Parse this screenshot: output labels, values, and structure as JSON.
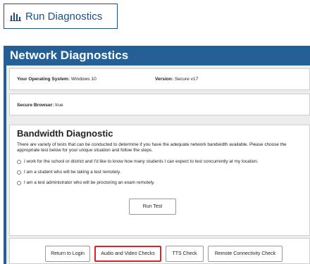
{
  "run_diagnostics": {
    "label": "Run Diagnostics",
    "icon": "bar-chart-icon"
  },
  "panel": {
    "title": "Network Diagnostics",
    "header_color": "#245f95"
  },
  "system_info": {
    "os_label": "Your Operating System:",
    "os_value": "Windows 10",
    "version_label": "Version:",
    "version_value": "Secure v17",
    "secure_browser_label": "Secure Browser:",
    "secure_browser_value": "true"
  },
  "bandwidth": {
    "title": "Bandwidth Diagnostic",
    "description": "There are variety of tests that can be conducted to determine if you have the adequate network bandwidth available. Please choose the appropriate test below for your unique situation and follow the steps.",
    "options": [
      "I work for the school or district and I'd like to know how many students I can expect to test concurrently at my location.",
      "I am a student who will be taking a test remotely.",
      "I am a test administrator who will be proctoring an exam remotely."
    ],
    "run_test_label": "Run Test"
  },
  "footer": {
    "buttons": [
      "Return to Login",
      "Audio and Video Checks",
      "TTS Check",
      "Remote Connectivity Check"
    ],
    "highlight_color": "#d8232a"
  }
}
